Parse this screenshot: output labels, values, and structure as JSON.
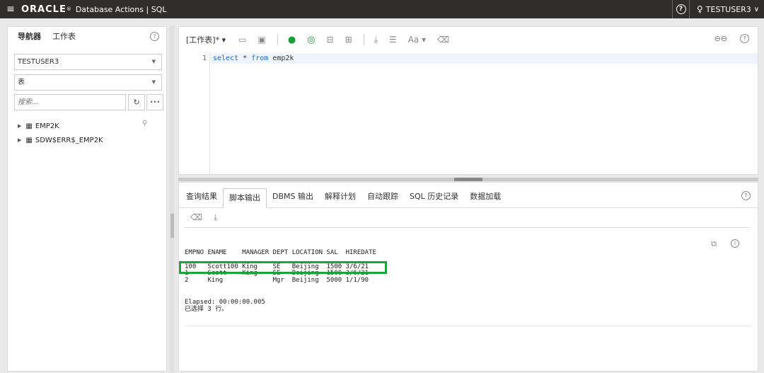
{
  "topbar": {
    "menu_icon": "≡",
    "logo": "ORACLE",
    "logo_sup": "®",
    "product": "Database Actions | SQL",
    "help_icon": "?",
    "user_icon": "♀",
    "user": "TESTUSER3",
    "user_chevron": "∨"
  },
  "navigator": {
    "tabs": [
      "导航器",
      "工作表"
    ],
    "help_icon": "?",
    "schema": "TESTUSER3",
    "object_type": "表",
    "select_arrow": "▼",
    "search_placeholder": "搜索...",
    "refresh_icon": "↻",
    "more_icon": "•••",
    "pin_icon": "⚲",
    "items": [
      {
        "label": "EMP2K"
      },
      {
        "label": "SDW$ERR$_EMP2K"
      }
    ]
  },
  "worksheet": {
    "name": "[工作表]*",
    "name_arrow": "▾",
    "icons": {
      "folder": "▭",
      "save": "▣",
      "run": "●",
      "run_script": "◎",
      "explain": "⊟",
      "autotrace": "⊞",
      "download": "⤓",
      "format": "☰",
      "case": "Aa ▾",
      "clear": "⌫",
      "binoculars": "⊖⊖",
      "help": "?"
    },
    "line_number": "1",
    "code": {
      "kw1": "select",
      "mid": " * ",
      "kw2": "from",
      "rest": " emp2k"
    }
  },
  "output": {
    "tabs": [
      "查询结果",
      "脚本输出",
      "DBMS 输出",
      "解释计划",
      "自动跟踪",
      "SQL 历史记录",
      "数据加载"
    ],
    "active_tab": "脚本输出",
    "help_icon": "?",
    "tool_icons": {
      "clear": "⌫",
      "download": "⤓",
      "copy": "⧉",
      "info": "i"
    },
    "header": "EMPNO ENAME    MANAGER DEPT LOCATION SAL  HIREDATE",
    "rows": [
      "100   Scott100 King    SE   Beijing  1500 3/6/21",
      "1     Scott    King    SE   Beijing  1500 3/6/21",
      "2     King             Mgr  Beijing  5000 1/1/90"
    ],
    "elapsed": "Elapsed: 00:00:00.005",
    "selected": "已选择 3 行。"
  }
}
